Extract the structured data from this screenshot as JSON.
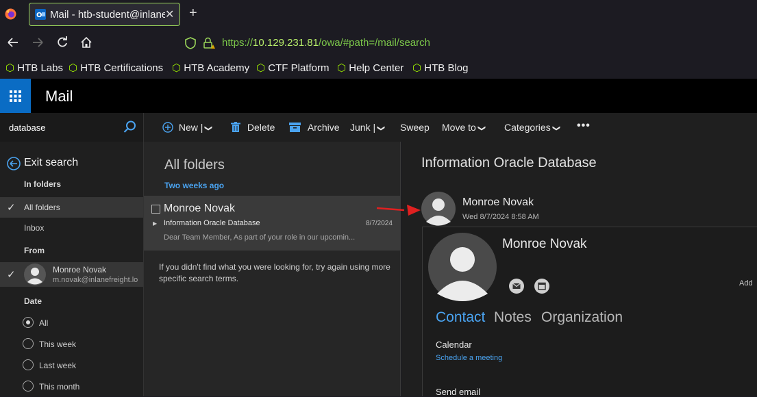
{
  "browser": {
    "tab_title": "Mail - htb-student@inlanefreight.local",
    "url_prefix": "https://",
    "url_host": "10.129.231.81",
    "url_path": "/owa/#path=/mail/search",
    "bookmarks": [
      "HTB Labs",
      "HTB Certifications",
      "HTB Academy",
      "CTF Platform",
      "Help Center",
      "HTB Blog"
    ]
  },
  "app": {
    "title": "Mail"
  },
  "search": {
    "query": "database"
  },
  "nav": {
    "exit_search": "Exit search",
    "in_folders_heading": "In folders",
    "folders": [
      "All folders",
      "Inbox"
    ],
    "from_heading": "From",
    "from_person": {
      "name": "Monroe Novak",
      "email": "m.novak@inlanefreight.local"
    },
    "date_heading": "Date",
    "date_options": [
      "All",
      "This week",
      "Last week",
      "This month"
    ]
  },
  "toolbar": {
    "new": "New",
    "delete": "Delete",
    "archive": "Archive",
    "junk": "Junk",
    "sweep": "Sweep",
    "move_to": "Move to",
    "categories": "Categories"
  },
  "list": {
    "title": "All folders",
    "group_label": "Two weeks ago",
    "message": {
      "sender": "Monroe Novak",
      "subject": "Information Oracle Database",
      "date": "8/7/2024",
      "preview": "Dear Team Member,  As part of your role in our upcomin..."
    },
    "not_found": "If you didn't find what you were looking for, try again using more specific search terms."
  },
  "reading": {
    "subject": "Information Oracle Database",
    "sender": "Monroe Novak",
    "datetime": "Wed 8/7/2024 8:58 AM"
  },
  "card": {
    "name": "Monroe Novak",
    "add_label": "Add",
    "tabs": [
      "Contact",
      "Notes",
      "Organization"
    ],
    "calendar_label": "Calendar",
    "schedule_link": "Schedule a meeting",
    "send_email_label": "Send email"
  },
  "colors": {
    "accent": "#4aa3f0",
    "tab_border": "#9bd75a",
    "url_green": "#7cc84a",
    "waffle_blue": "#0a6cc4",
    "annotation_arrow": "#e02020"
  }
}
